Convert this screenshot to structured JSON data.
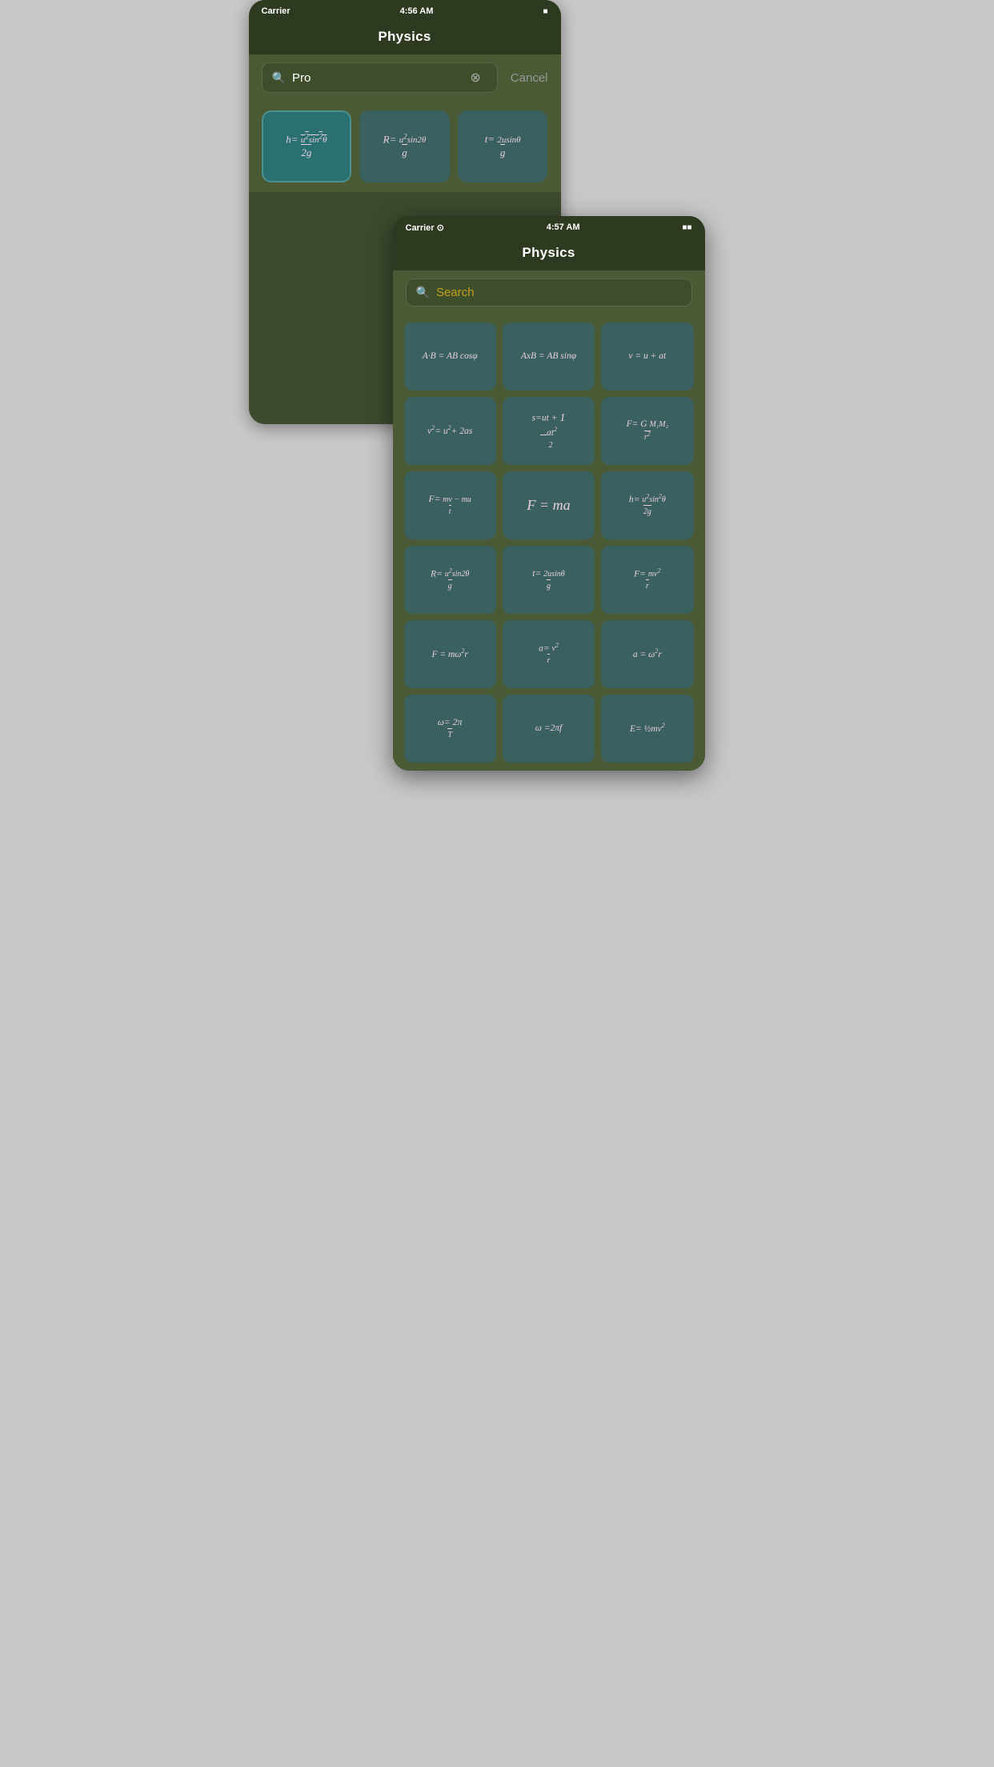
{
  "phone1": {
    "status": {
      "carrier": "Carrier",
      "time": "4:56 AM",
      "battery": "■■■"
    },
    "title": "Physics",
    "search": {
      "placeholder": "Pro",
      "cancel_label": "Cancel"
    },
    "formulas": [
      {
        "id": "h-formula",
        "text": "h= u²sin²θ / 2g",
        "highlight": true
      },
      {
        "id": "R-formula",
        "text": "R= u²sin2θ / g"
      },
      {
        "id": "t-formula",
        "text": "t= 2usinθ / g"
      }
    ]
  },
  "phone2": {
    "status": {
      "carrier": "Carrier",
      "time": "4:57 AM",
      "battery": "■■■"
    },
    "title": "Physics",
    "search": {
      "placeholder": "Search"
    },
    "formulas": [
      {
        "id": "dot-product",
        "text": "A·B = AB cosφ"
      },
      {
        "id": "cross-product",
        "text": "AxB = AB sinφ"
      },
      {
        "id": "v-u-at",
        "text": "v = u + at"
      },
      {
        "id": "v2-u2",
        "text": "v²= u²+ 2as"
      },
      {
        "id": "s-ut",
        "text": "s=ut + ½at²"
      },
      {
        "id": "gravity-force",
        "text": "F= G M₁M₂ / r²"
      },
      {
        "id": "impulse",
        "text": "F= mv − mu / t"
      },
      {
        "id": "newton2",
        "text": "F = ma"
      },
      {
        "id": "h-max",
        "text": "h= u²sin²θ / 2g"
      },
      {
        "id": "range",
        "text": "R= u²sin2θ / g"
      },
      {
        "id": "time-flight",
        "text": "t= 2usinθ / g"
      },
      {
        "id": "centripetal-force",
        "text": "F= mv² / r"
      },
      {
        "id": "centripetal-f2",
        "text": "F = mω²r"
      },
      {
        "id": "centripetal-a",
        "text": "a= v² / r"
      },
      {
        "id": "angular-a",
        "text": "a = ω²r"
      },
      {
        "id": "omega-T",
        "text": "ω= 2π / T"
      },
      {
        "id": "omega-f",
        "text": "ω =2πf"
      },
      {
        "id": "kinetic-energy",
        "text": "E= ½mv²"
      }
    ]
  }
}
